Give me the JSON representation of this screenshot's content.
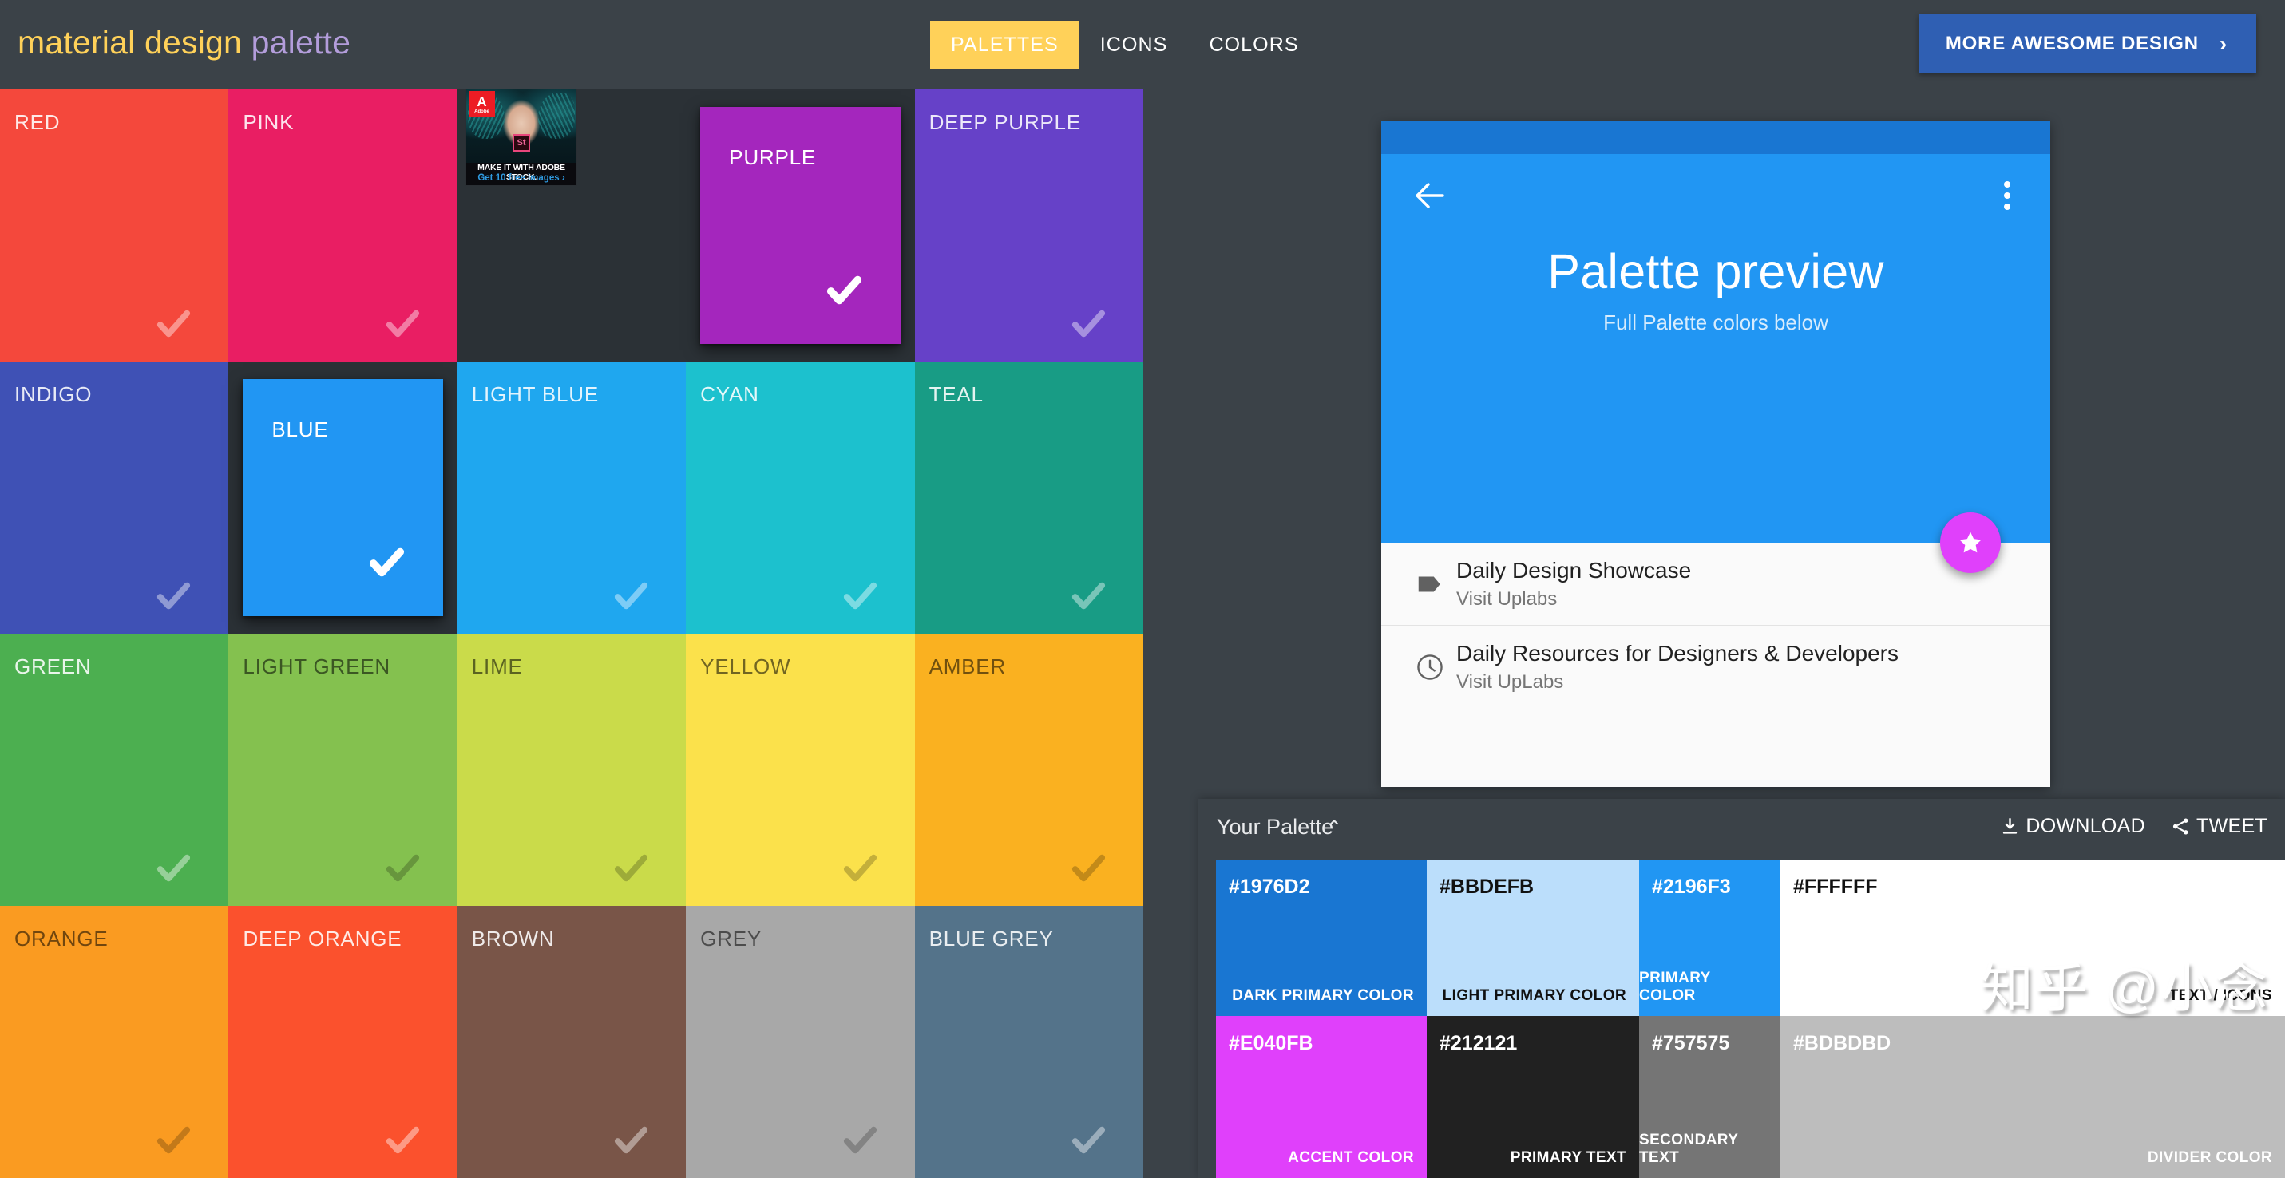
{
  "header": {
    "brand_part1": "material design",
    "brand_part2": "palette",
    "nav": [
      {
        "label": "PALETTES",
        "active": true
      },
      {
        "label": "ICONS",
        "active": false
      },
      {
        "label": "COLORS",
        "active": false
      }
    ],
    "cta_label": "MORE AWESOME DESIGN",
    "cta_chevron": "›"
  },
  "ad": {
    "brand_letter": "A",
    "brand_name": "Adobe",
    "product_badge": "St",
    "caption_line1": "MAKE IT WITH ADOBE STOCK.",
    "caption_line2": "Get 10 free images ›"
  },
  "swatches": [
    {
      "name": "RED",
      "color": "#F4483C",
      "dark_text": false,
      "raised": false
    },
    {
      "name": "PINK",
      "color": "#E91E63",
      "dark_text": false,
      "raised": false
    },
    {
      "name": "",
      "color": "",
      "dark_text": false,
      "raised": false,
      "ad_slot": true
    },
    {
      "name": "PURPLE",
      "color": "#A426BD",
      "dark_text": false,
      "raised": true
    },
    {
      "name": "DEEP PURPLE",
      "color": "#6641C8",
      "dark_text": false,
      "raised": false
    },
    {
      "name": "INDIGO",
      "color": "#3F51B5",
      "dark_text": false,
      "raised": false
    },
    {
      "name": "BLUE",
      "color": "#2196F3",
      "dark_text": false,
      "raised": true
    },
    {
      "name": "LIGHT BLUE",
      "color": "#1FA7EF",
      "dark_text": false,
      "raised": false
    },
    {
      "name": "CYAN",
      "color": "#1CC1CE",
      "dark_text": false,
      "raised": false
    },
    {
      "name": "TEAL",
      "color": "#189C85",
      "dark_text": false,
      "raised": false
    },
    {
      "name": "GREEN",
      "color": "#4CAF50",
      "dark_text": false,
      "raised": false
    },
    {
      "name": "LIGHT GREEN",
      "color": "#84C14F",
      "dark_text": true,
      "raised": false
    },
    {
      "name": "LIME",
      "color": "#CADB4A",
      "dark_text": true,
      "raised": false
    },
    {
      "name": "YELLOW",
      "color": "#FBE14B",
      "dark_text": true,
      "raised": false
    },
    {
      "name": "AMBER",
      "color": "#FAB120",
      "dark_text": true,
      "raised": false
    },
    {
      "name": "ORANGE",
      "color": "#FA9B21",
      "dark_text": true,
      "raised": false
    },
    {
      "name": "DEEP ORANGE",
      "color": "#FB512D",
      "dark_text": false,
      "raised": false
    },
    {
      "name": "BROWN",
      "color": "#795548",
      "dark_text": false,
      "raised": false
    },
    {
      "name": "GREY",
      "color": "#A8A8A8",
      "dark_text": true,
      "raised": false
    },
    {
      "name": "BLUE GREY",
      "color": "#54738A",
      "dark_text": false,
      "raised": false
    }
  ],
  "preview": {
    "status_color": "#1976D2",
    "appbar_color": "#2196F3",
    "fab_color": "#E040FB",
    "title": "Palette preview",
    "subtitle": "Full Palette colors below",
    "list": [
      {
        "title": "Daily Design Showcase",
        "subtitle": "Visit Uplabs",
        "icon": "label-icon"
      },
      {
        "title": "Daily Resources for Designers & Developers",
        "subtitle": "Visit UpLabs",
        "icon": "clock-icon"
      }
    ]
  },
  "your_palette": {
    "title": "Your Palette",
    "caret": "⌃",
    "download_label": "DOWNLOAD",
    "tweet_label": "TWEET",
    "cells": [
      {
        "hex": "#1976D2",
        "role": "DARK PRIMARY COLOR",
        "bg": "#1976D2",
        "text": "#ffffff"
      },
      {
        "hex": "#BBDEFB",
        "role": "LIGHT PRIMARY COLOR",
        "bg": "#BBDEFB",
        "text": "#111111"
      },
      {
        "hex": "#2196F3",
        "role": "PRIMARY COLOR",
        "bg": "#2196F3",
        "text": "#ffffff"
      },
      {
        "hex": "#FFFFFF",
        "role": "TEXT / ICONS",
        "bg": "#FFFFFF",
        "text": "#111111"
      },
      {
        "hex": "#E040FB",
        "role": "ACCENT COLOR",
        "bg": "#E040FB",
        "text": "#ffffff"
      },
      {
        "hex": "#212121",
        "role": "PRIMARY TEXT",
        "bg": "#212121",
        "text": "#ffffff"
      },
      {
        "hex": "#757575",
        "role": "SECONDARY TEXT",
        "bg": "#757575",
        "text": "#ffffff"
      },
      {
        "hex": "#BDBDBD",
        "role": "DIVIDER COLOR",
        "bg": "#BDBDBD",
        "text": "#ffffff"
      }
    ]
  },
  "watermark": "知乎 @小念"
}
